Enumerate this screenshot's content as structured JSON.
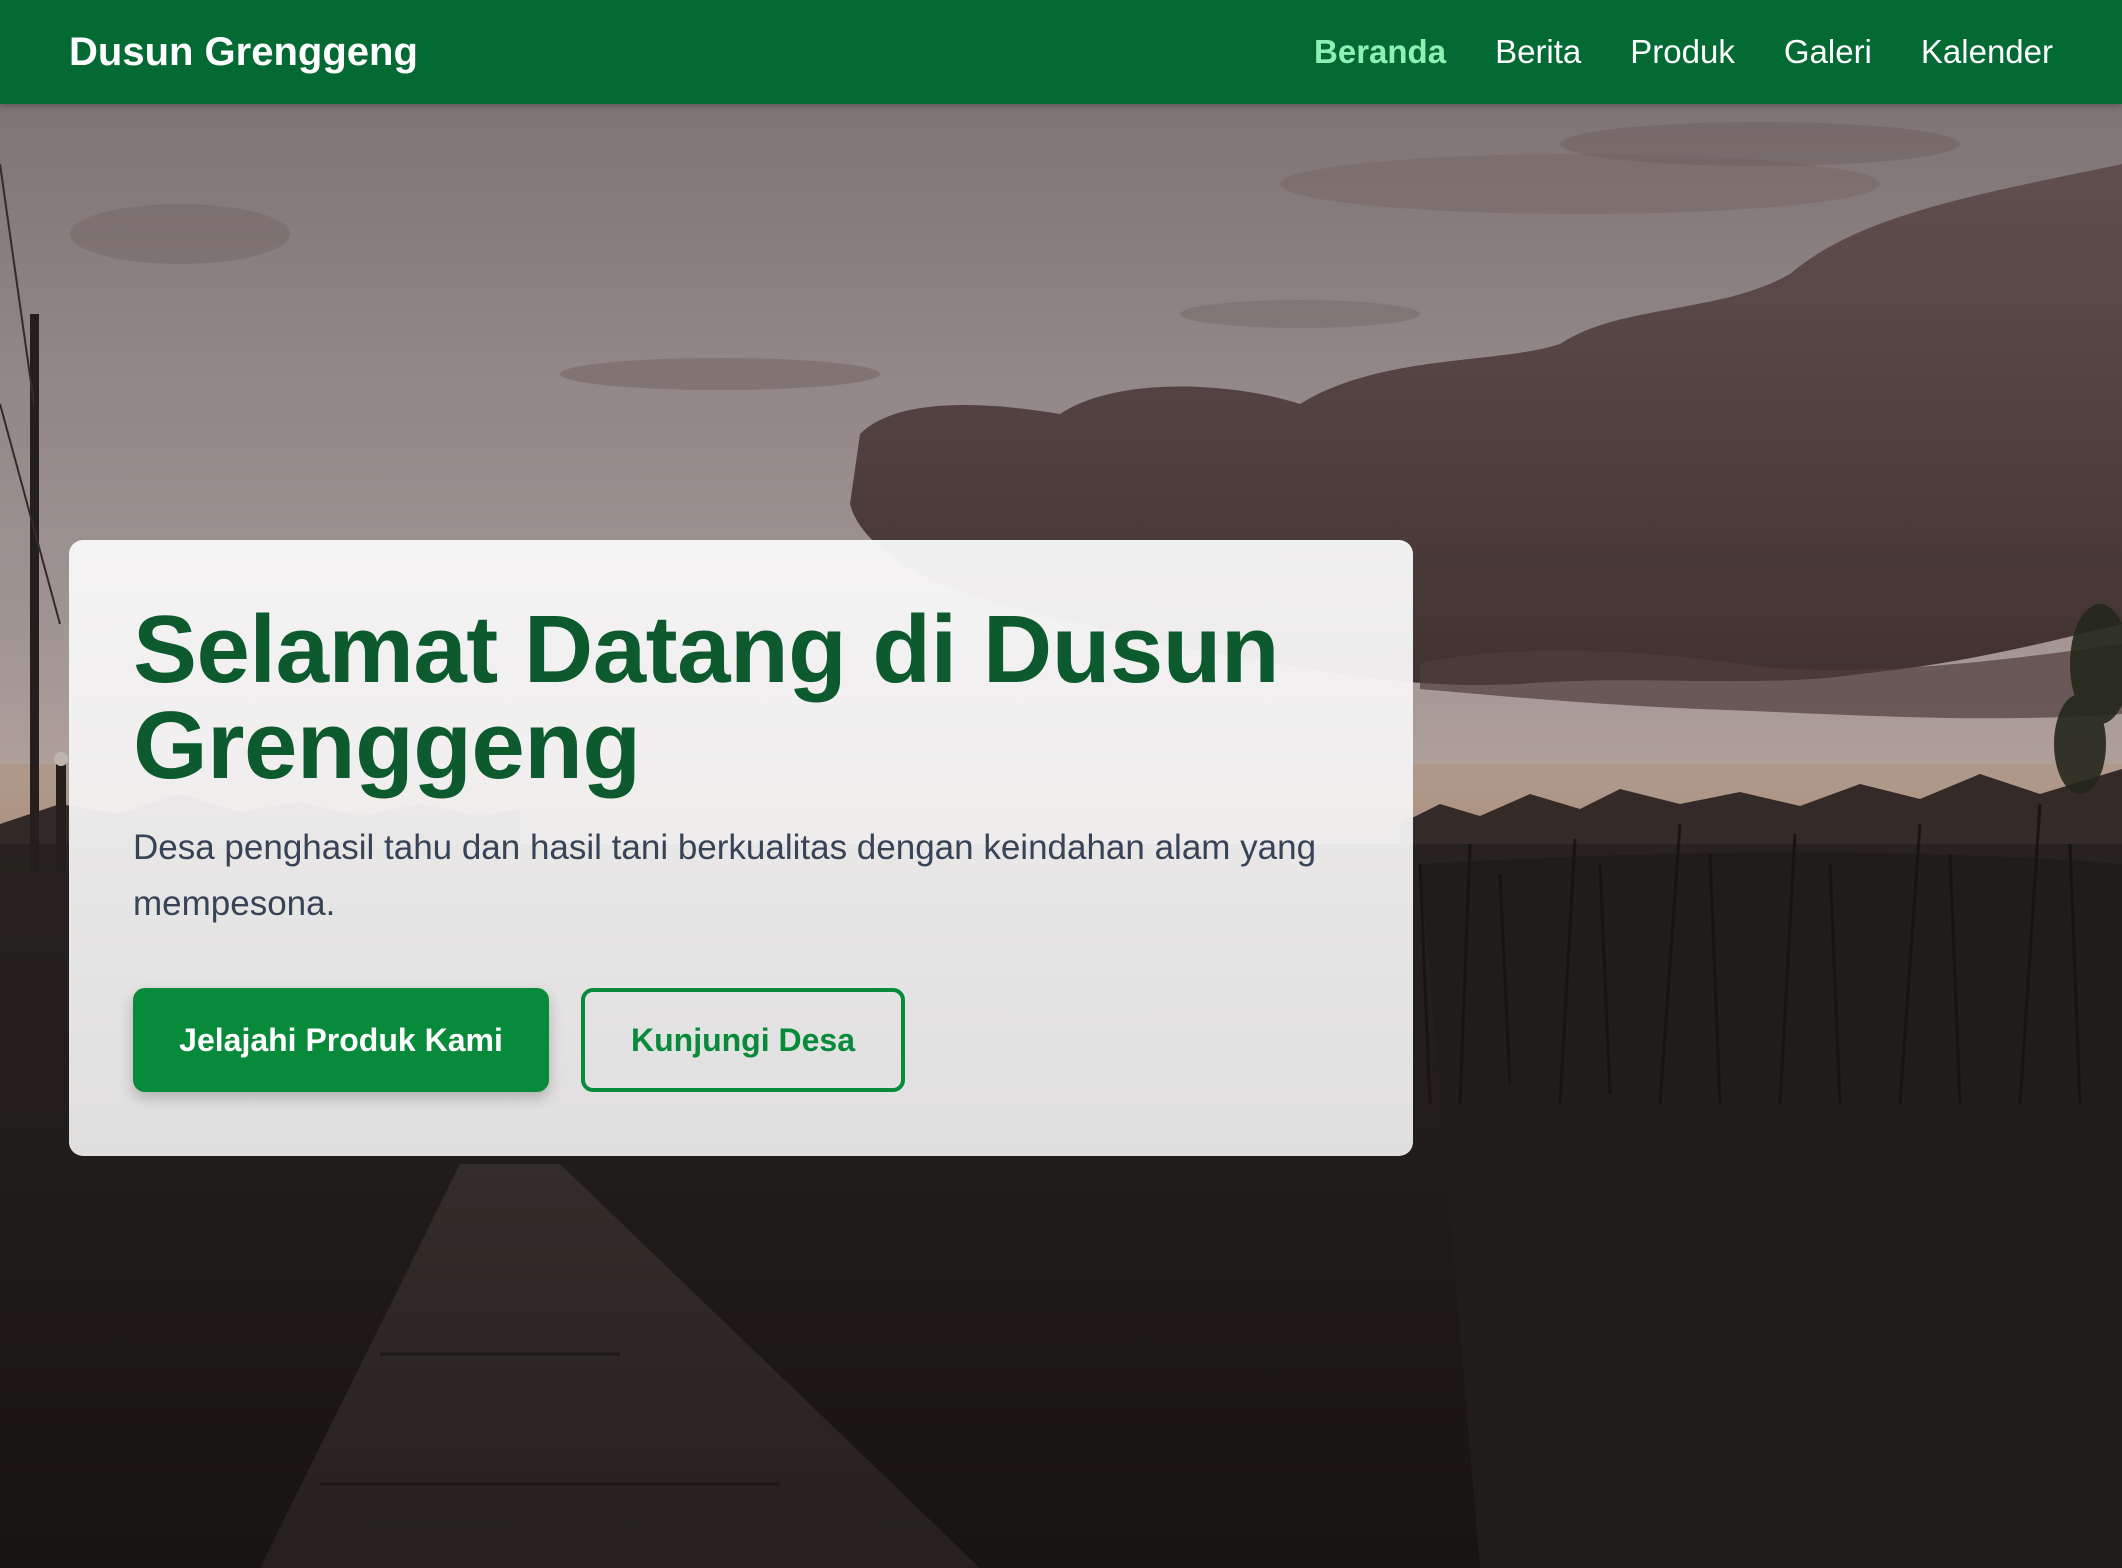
{
  "navbar": {
    "brand": "Dusun Grenggeng",
    "links": [
      {
        "label": "Beranda",
        "active": true
      },
      {
        "label": "Berita",
        "active": false
      },
      {
        "label": "Produk",
        "active": false
      },
      {
        "label": "Galeri",
        "active": false
      },
      {
        "label": "Kalender",
        "active": false
      }
    ]
  },
  "hero": {
    "title": "Selamat Datang di Dusun Grenggeng",
    "subtitle": "Desa penghasil tahu dan hasil tani berkualitas dengan keindahan alam yang mempesona.",
    "primary_button": "Jelajahi Produk Kami",
    "secondary_button": "Kunjungi Desa",
    "background_image": "dusk-rice-field-with-clouds"
  },
  "colors": {
    "brand_green": "#036a34",
    "active_link": "#8ff0b4",
    "title_green": "#0c5a2e",
    "button_green": "#078a39",
    "subtitle_text": "#374356"
  }
}
